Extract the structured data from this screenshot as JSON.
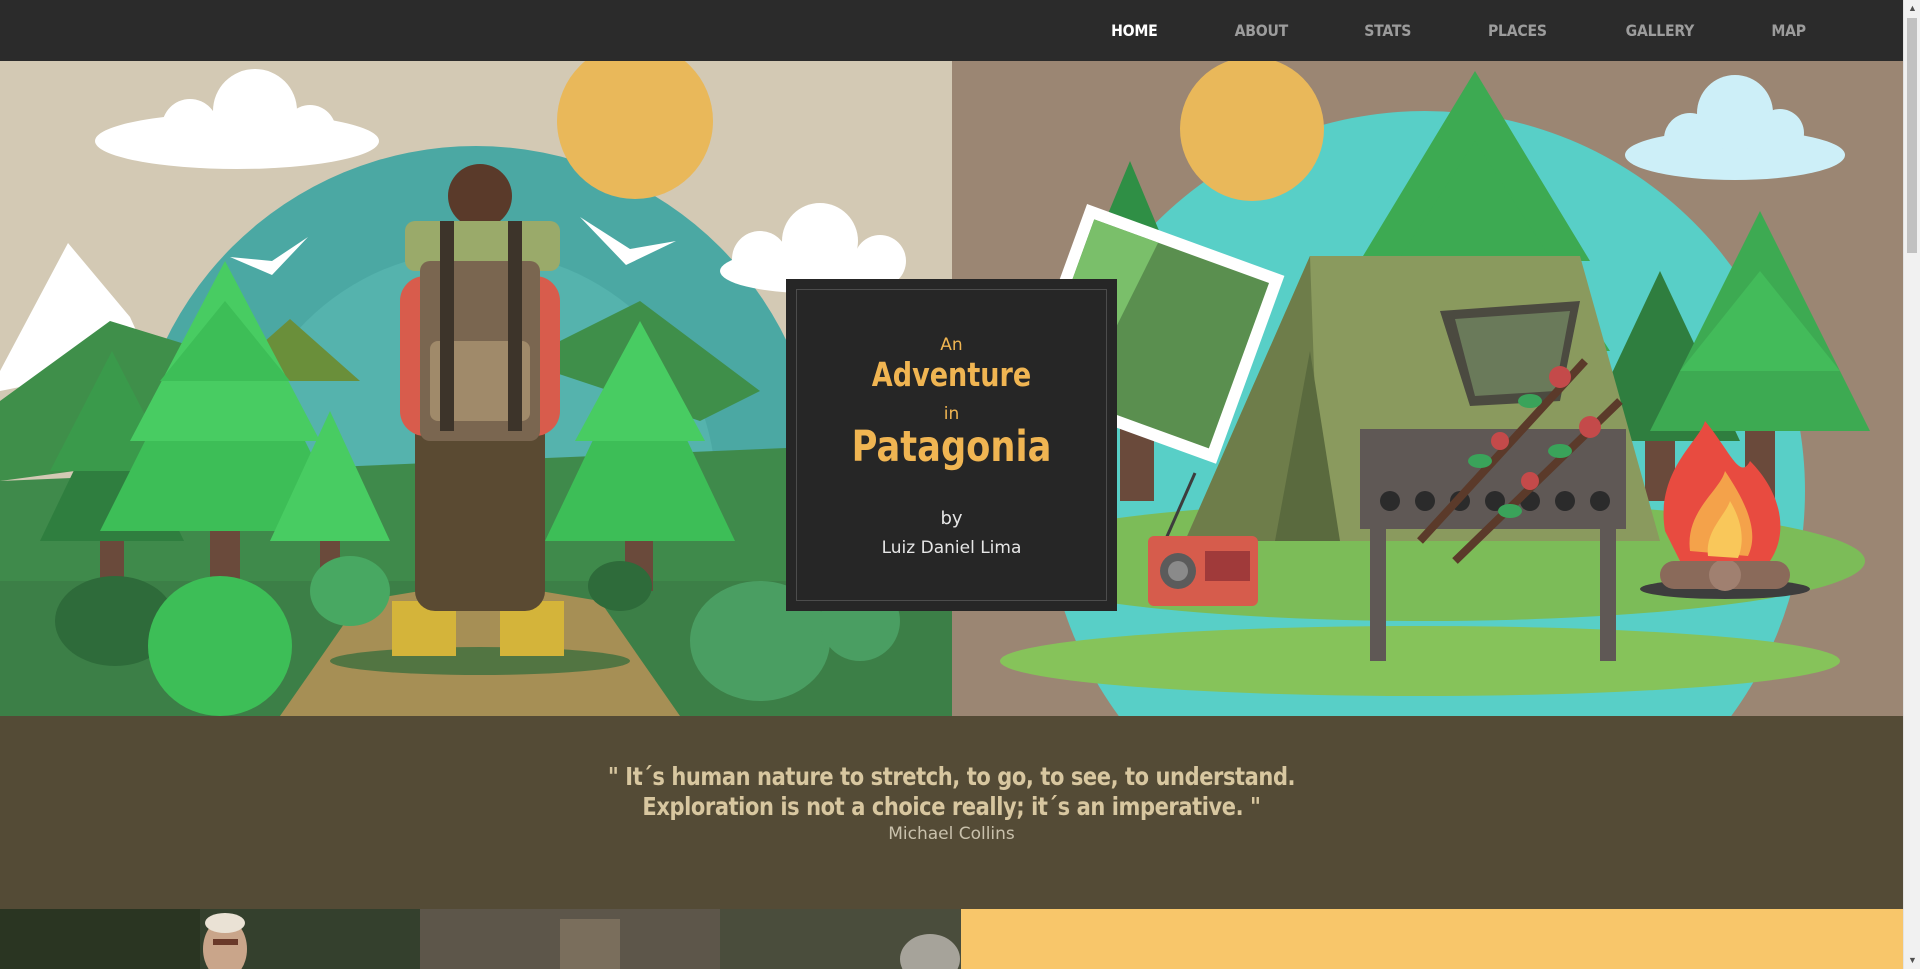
{
  "nav": {
    "items": [
      {
        "label": "HOME",
        "active": true
      },
      {
        "label": "ABOUT"
      },
      {
        "label": "STATS"
      },
      {
        "label": "PLACES"
      },
      {
        "label": "GALLERY"
      },
      {
        "label": "MAP"
      }
    ]
  },
  "hero": {
    "an": "An",
    "adventure": "Adventure",
    "in": "in",
    "patagonia": "Patagonia",
    "by": "by",
    "author": "Luiz Daniel Lima"
  },
  "quote": {
    "line1": "\" It´s human nature to stretch, to go, to see, to understand.",
    "line2": "Exploration is not a choice really; it´s an imperative. \"",
    "attribution": "Michael Collins"
  },
  "colors": {
    "nav_bg": "#2b2b2b",
    "accent_gold": "#f0b552",
    "quote_bg": "#544b36",
    "yellow_panel": "#f8c66a"
  }
}
